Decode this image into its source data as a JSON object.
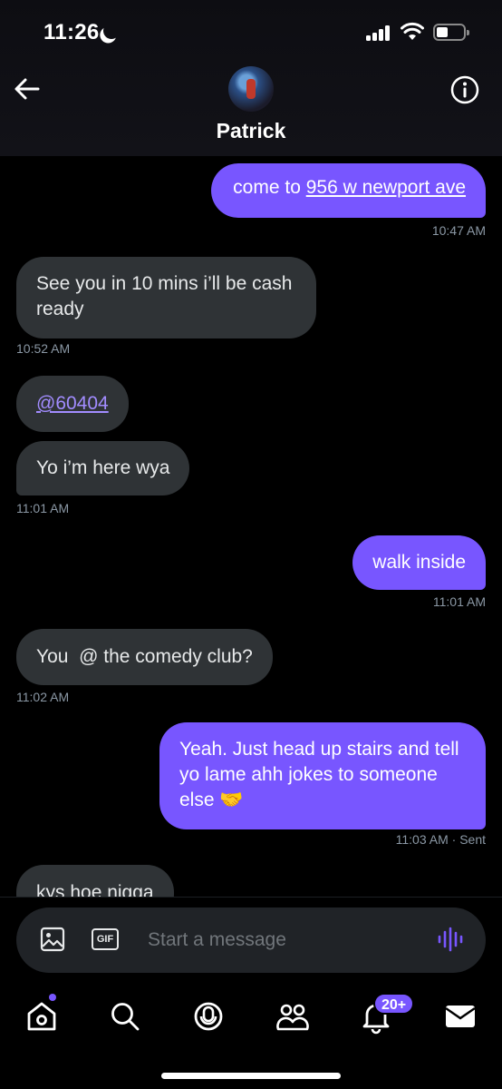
{
  "status_bar": {
    "time": "11:26"
  },
  "header": {
    "contact_name": "Patrick"
  },
  "messages": [
    {
      "dir": "out",
      "prefix": "come to ",
      "link": "956 w newport ave",
      "time": "10:47 AM"
    },
    {
      "dir": "in",
      "line1": "See you in 10 mins i’ll be cash",
      "line2": "ready",
      "time": "10:52 AM"
    },
    {
      "dir": "in",
      "mention": "@60404"
    },
    {
      "dir": "in",
      "text": "Yo i’m here wya",
      "time": "11:01 AM"
    },
    {
      "dir": "out",
      "text": "walk inside",
      "time": "11:01 AM"
    },
    {
      "dir": "in",
      "text": "You  @ the comedy club?",
      "time": "11:02 AM"
    },
    {
      "dir": "out",
      "line1": "Yeah. Just head up stairs and tell",
      "line2": "yo lame ahh jokes to someone",
      "line3": "else 🤝",
      "time": "11:03 AM",
      "status": " · Sent"
    },
    {
      "dir": "in",
      "text": "kys hoe nigga"
    }
  ],
  "composer": {
    "placeholder": "Start a message",
    "gif_label": "GIF"
  },
  "tabbar": {
    "notifications_badge": "20+"
  },
  "colors": {
    "accent": "#7856ff",
    "incoming_bubble": "#2f3336",
    "background": "#000000"
  }
}
